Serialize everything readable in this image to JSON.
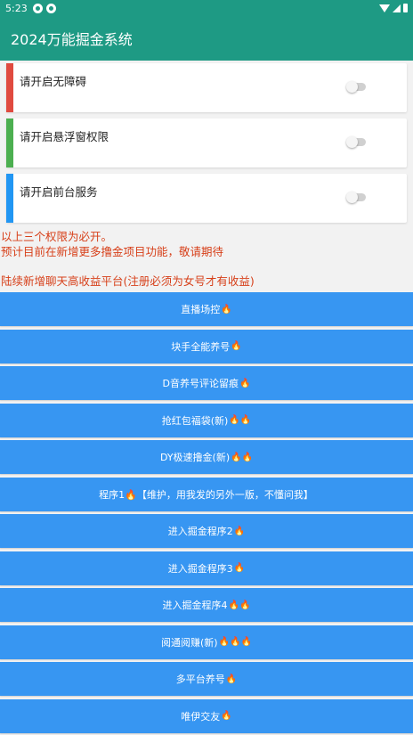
{
  "status_bar": {
    "time": "5:23"
  },
  "app": {
    "title": "2024万能掘金系统"
  },
  "permissions": [
    {
      "label": "请开启无障碍",
      "color": "#e04a3f",
      "enabled": false
    },
    {
      "label": "请开启悬浮窗权限",
      "color": "#4caf50",
      "enabled": false
    },
    {
      "label": "请开启前台服务",
      "color": "#2196f3",
      "enabled": false
    }
  ],
  "notices": {
    "line1": "以上三个权限为必开。",
    "line2": "预计目前在新增更多撸金项目功能，敬请期待",
    "line3": "陆续新增聊天高收益平台(注册必须为女号才有收益)"
  },
  "buttons": [
    {
      "label": "直播场控",
      "fire": "🔥"
    },
    {
      "label": "块手全能养号",
      "fire": "🔥"
    },
    {
      "label": "D音养号评论留痕",
      "fire": "🔥"
    },
    {
      "label": "抢红包福袋(新)",
      "fire": "🔥🔥"
    },
    {
      "label": "DY极速撸金(新)",
      "fire": "🔥🔥"
    },
    {
      "label": "程序1🔥【维护，用我发的另外一版，不懂问我】",
      "fire": ""
    },
    {
      "label": "进入掘金程序2",
      "fire": "🔥"
    },
    {
      "label": "进入掘金程序3",
      "fire": "🔥"
    },
    {
      "label": "进入掘金程序4",
      "fire": "🔥🔥"
    },
    {
      "label": "阅通阅赚(新)",
      "fire": "🔥🔥🔥"
    },
    {
      "label": "多平台养号",
      "fire": "🔥"
    },
    {
      "label": "唯伊交友",
      "fire": "🔥"
    }
  ]
}
